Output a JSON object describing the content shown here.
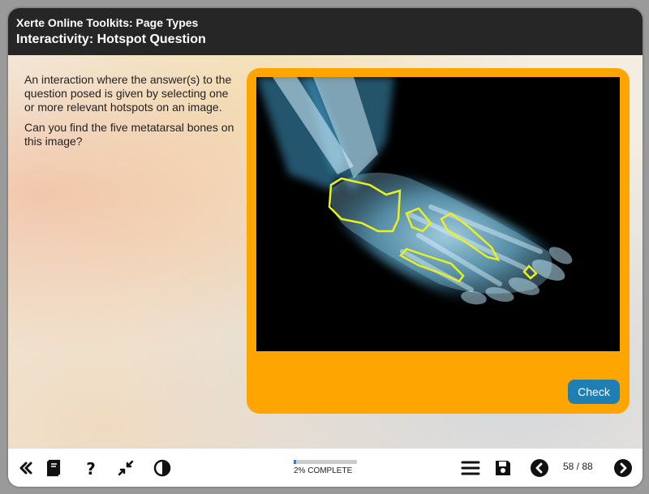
{
  "header": {
    "title": "Xerte Online Toolkits: Page Types",
    "page_title": "Interactivity: Hotspot Question"
  },
  "content": {
    "paragraphs": [
      "An interaction where the answer(s) to the question posed is given by selecting one or more relevant hotspots on an image.",
      "Can you find the five metatarsal bones on this image?"
    ],
    "check_label": "Check"
  },
  "footer": {
    "icons": [
      "first-page-icon",
      "glossary-book-icon",
      "help-icon",
      "minimize-icon",
      "contrast-icon",
      "menu-icon",
      "save-icon",
      "previous-icon",
      "next-icon"
    ],
    "progress_percent": 2,
    "progress_label": "2% COMPLETE",
    "page_counter": "58 / 88"
  },
  "colors": {
    "header_bg": "#262626",
    "panel": "#ffa500",
    "check_button": "#1f7fb3",
    "hotspot_outline": "#e8f020",
    "progress_fill": "#2f80c8"
  }
}
